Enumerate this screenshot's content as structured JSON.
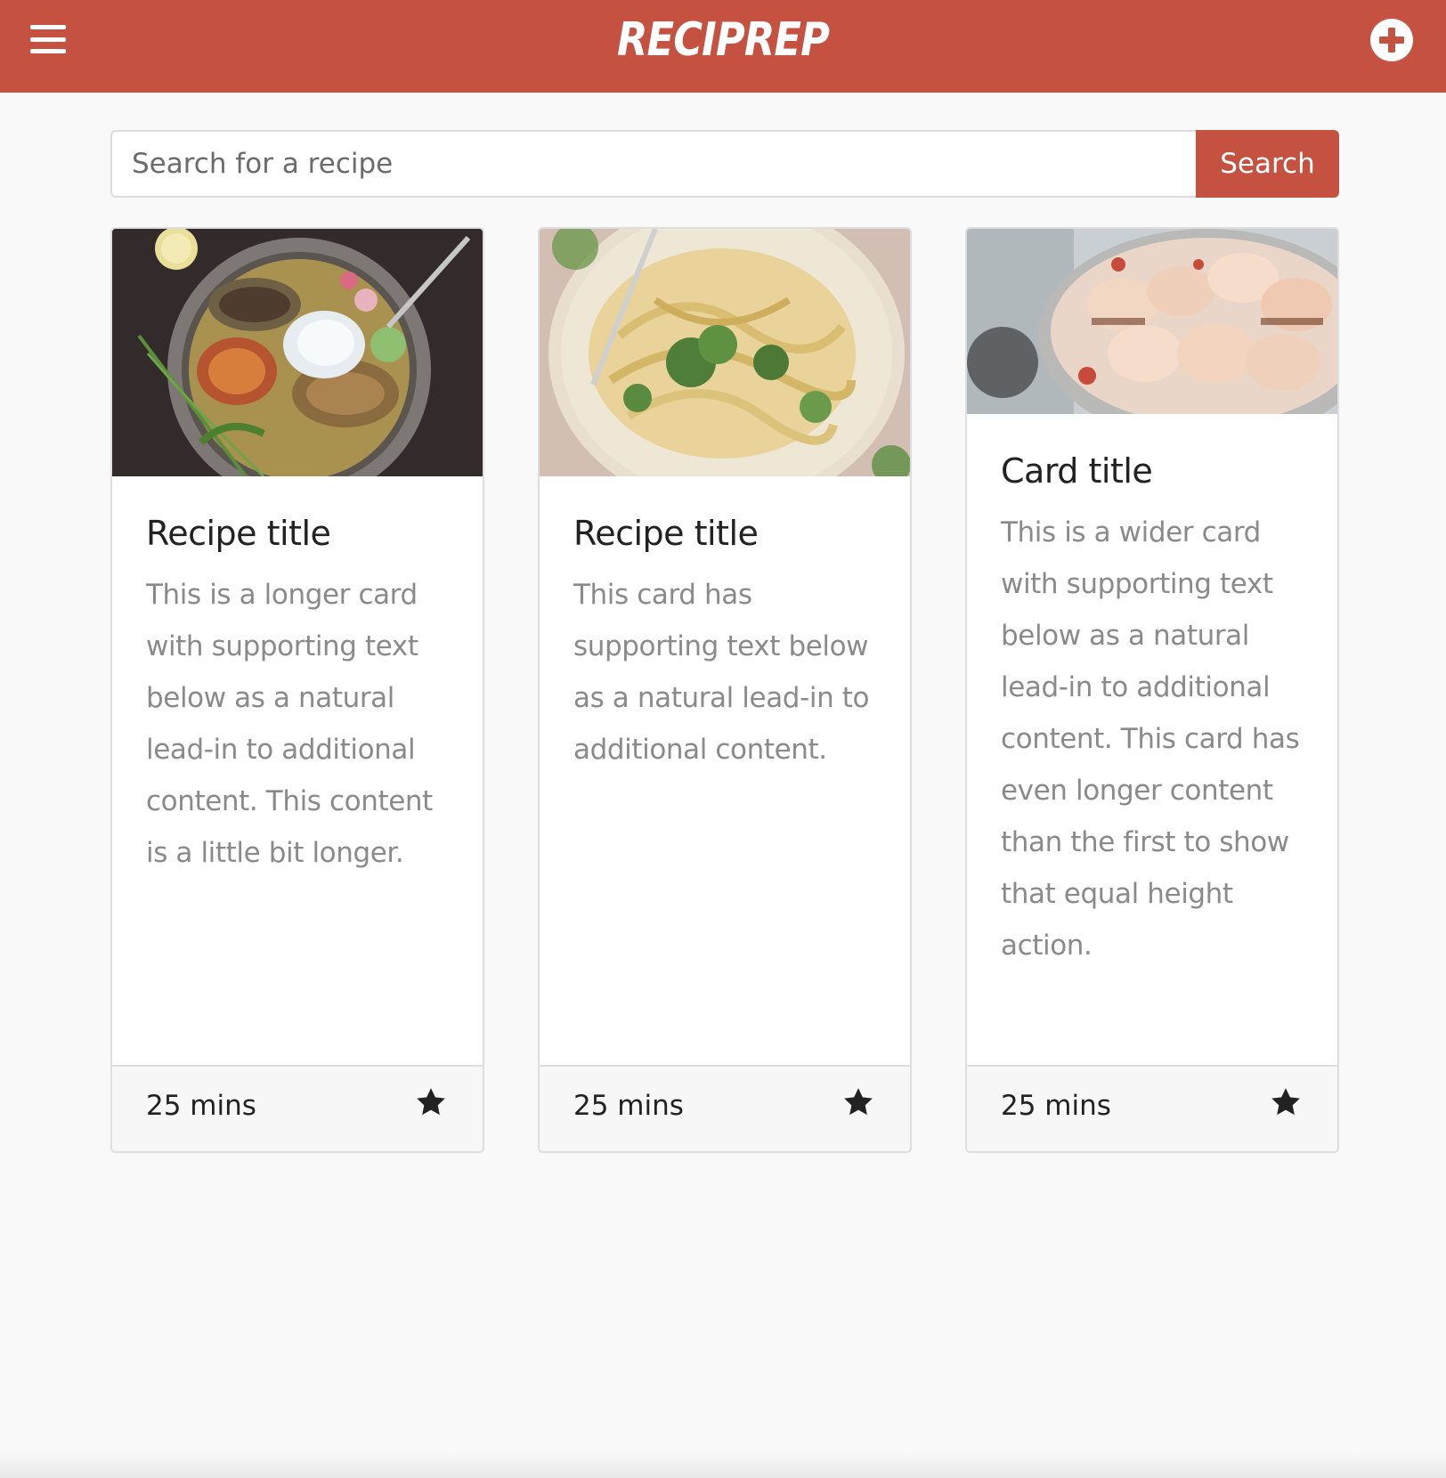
{
  "header": {
    "brand": "RECIPREP",
    "menu_icon": "hamburger-menu-icon",
    "add_icon": "plus-circle-icon"
  },
  "search": {
    "placeholder": "Search for a recipe",
    "button_label": "Search"
  },
  "cards": [
    {
      "title": "Recipe title",
      "text": "This is a longer card with supporting text below as a natural lead-in to additional content. This content is a little bit longer.",
      "time": "25 mins",
      "image": "grilled-chicken-bowl-photo",
      "icon": "star-icon"
    },
    {
      "title": "Recipe title",
      "text": "This card has supporting text below as a natural lead-in to additional content.",
      "time": "25 mins",
      "image": "pasta-plate-photo",
      "icon": "star-icon"
    },
    {
      "title": "Card title",
      "text": "This is a wider card with supporting text below as a natural lead-in to additional content. This card has even longer content than the first to show that equal height action.",
      "time": "25 mins",
      "image": "macarons-bowl-photo",
      "icon": "star-icon"
    }
  ],
  "colors": {
    "brand": "#c55141",
    "background": "#f9f9f9",
    "title_text": "#222222",
    "body_text": "#8a8a8a"
  }
}
